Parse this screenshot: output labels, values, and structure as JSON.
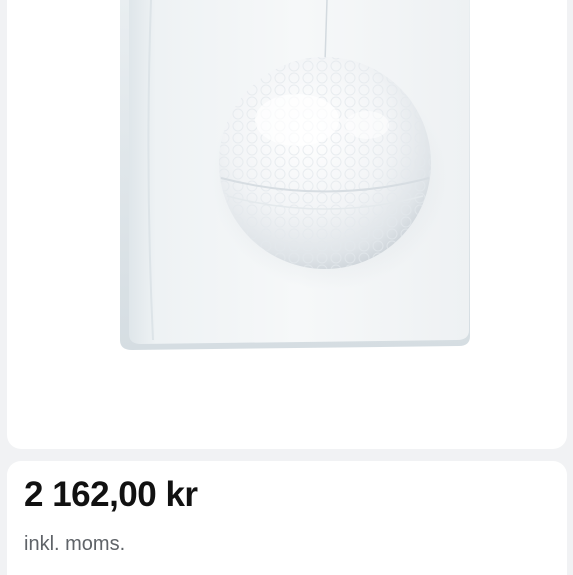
{
  "product": {
    "image_description_icon": "motion-sensor-photo"
  },
  "pricing": {
    "price": "2 162,00 kr",
    "vat_note": "inkl. moms."
  }
}
